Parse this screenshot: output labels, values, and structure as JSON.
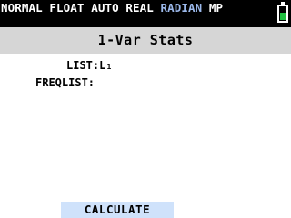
{
  "status_bar": {
    "modes": [
      "NORMAL",
      "FLOAT",
      "AUTO",
      "REAL"
    ],
    "angle_mode": "RADIAN",
    "mp": "MP",
    "battery_level": 0.55,
    "battery_color": "#20c040",
    "accent_color": "#9bb8ea"
  },
  "screen": {
    "title": "1-Var Stats",
    "list_label": "LIST:",
    "list_value": "L₁",
    "freqlist_label": "FREQLIST:",
    "freqlist_value": "",
    "calculate_label": "CALCULATE"
  }
}
